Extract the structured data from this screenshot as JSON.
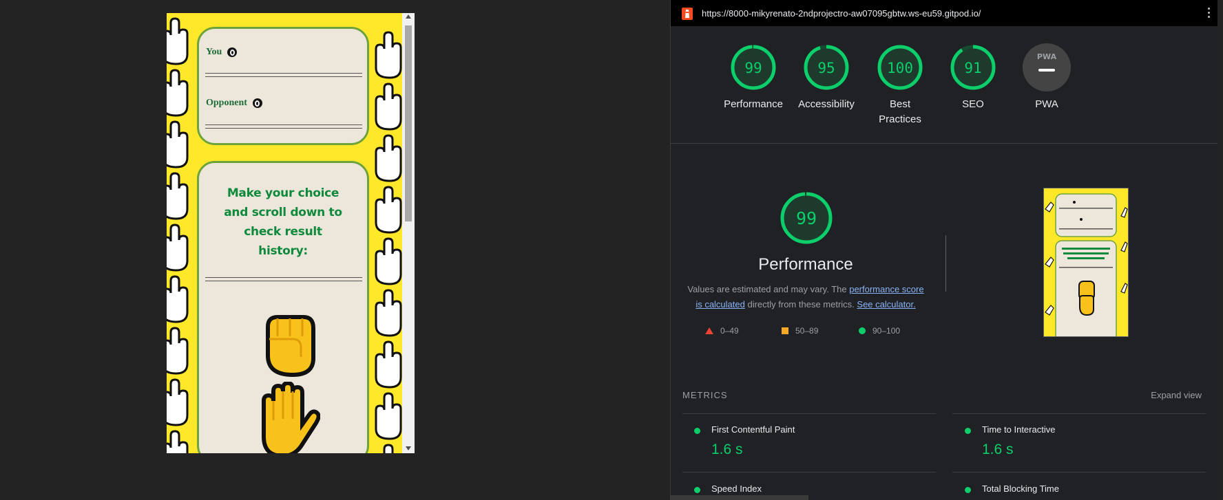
{
  "preview": {
    "score_card": {
      "you_label": "You",
      "opponent_label": "Opponent"
    },
    "choice_card": {
      "title_lines": [
        "Make your choice",
        "and scroll down to",
        "check result",
        "history:"
      ]
    },
    "choices": [
      {
        "icon": "fist-icon"
      },
      {
        "icon": "raised-hand-icon"
      }
    ]
  },
  "lighthouse": {
    "url": "https://8000-mikyrenato-2ndprojectro-aw07095gbtw.ws-eu59.gitpod.io/",
    "gauges": [
      {
        "score": "99",
        "label_lines": [
          "Performance"
        ]
      },
      {
        "score": "95",
        "label_lines": [
          "Accessibility"
        ]
      },
      {
        "score": "100",
        "label_lines": [
          "Best",
          "Practices"
        ]
      },
      {
        "score": "91",
        "label_lines": [
          "SEO"
        ]
      },
      {
        "badge": "PWA",
        "label_lines": [
          "PWA"
        ]
      }
    ],
    "performance": {
      "score": "99",
      "title": "Performance",
      "note_before": "Values are estimated and may vary. The ",
      "note_link": "performance score is calculated",
      "note_middle": " directly from these metrics. ",
      "note_link2": "See calculator."
    },
    "legend": [
      {
        "shape": "triangle",
        "range": "0–49",
        "color": "#ea4335"
      },
      {
        "shape": "square",
        "range": "50–89",
        "color": "#f9a825"
      },
      {
        "shape": "circle",
        "range": "90–100",
        "color": "#0cce6b"
      }
    ],
    "metrics_title": "METRICS",
    "expand_label": "Expand view",
    "metrics": [
      {
        "name": "First Contentful Paint",
        "value": "1.6 s"
      },
      {
        "name": "Time to Interactive",
        "value": "1.6 s"
      },
      {
        "name": "Speed Index",
        "value": ""
      },
      {
        "name": "Total Blocking Time",
        "value": ""
      }
    ]
  },
  "colors": {
    "pass": "#0cce6b",
    "page_bg": "#232323",
    "panel_bg": "#202124",
    "card_border": "#6ea33b",
    "title_green": "#0f8a3c",
    "yellow": "#ffe82a"
  }
}
